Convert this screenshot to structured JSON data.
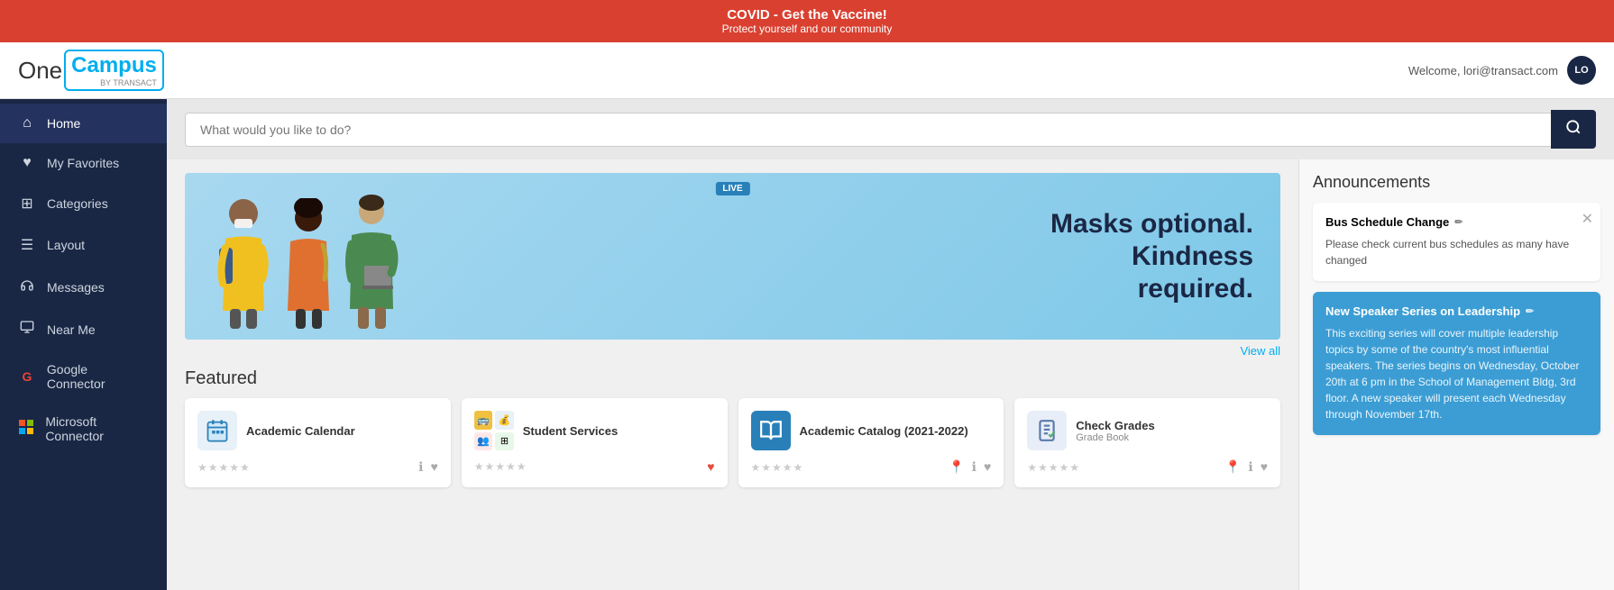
{
  "banner": {
    "title": "COVID - Get the Vaccine!",
    "subtitle": "Protect yourself and our community"
  },
  "header": {
    "logo_one": "One",
    "logo_campus": "Campus",
    "logo_by": "BY TRANSACT",
    "welcome_text": "Welcome, lori@transact.com",
    "avatar_initials": "LO"
  },
  "search": {
    "placeholder": "What would you like to do?"
  },
  "sidebar": {
    "items": [
      {
        "id": "home",
        "label": "Home",
        "icon": "⌂",
        "active": true
      },
      {
        "id": "my-favorites",
        "label": "My Favorites",
        "icon": "♥"
      },
      {
        "id": "categories",
        "label": "Categories",
        "icon": "⊞"
      },
      {
        "id": "layout",
        "label": "Layout",
        "icon": "≡"
      },
      {
        "id": "messages",
        "label": "Messages",
        "icon": "📶"
      },
      {
        "id": "near-me",
        "label": "Near Me",
        "icon": "🗺"
      },
      {
        "id": "google-connector",
        "label": "Google Connector",
        "icon": "G"
      },
      {
        "id": "microsoft-connector",
        "label": "Microsoft Connector",
        "icon": "⊞"
      }
    ]
  },
  "hero": {
    "line1": "Masks optional.",
    "line2": "Kindness",
    "line3": "required.",
    "badge": "LIVE"
  },
  "view_all_label": "View all",
  "featured": {
    "title": "Featured",
    "cards": [
      {
        "name": "Academic Calendar",
        "sub": "",
        "icon_type": "calendar",
        "has_heart": false,
        "has_location": false
      },
      {
        "name": "Student Services",
        "sub": "",
        "icon_type": "student-services",
        "has_heart": true,
        "has_location": false
      },
      {
        "name": "Academic Catalog (2021-2022)",
        "sub": "",
        "icon_type": "book",
        "has_heart": false,
        "has_location": true
      },
      {
        "name": "Check Grades",
        "sub": "Grade Book",
        "icon_type": "grades",
        "has_heart": false,
        "has_location": true
      }
    ]
  },
  "announcements": {
    "title": "Announcements",
    "items": [
      {
        "id": "bus-schedule",
        "title": "Bus Schedule Change",
        "text": "Please check current bus schedules as many have changed",
        "highlighted": false,
        "show_close": true
      },
      {
        "id": "speaker-series",
        "title": "New Speaker Series on Leadership",
        "text": "This exciting series will cover multiple leadership topics by some of the country's most influential speakers. The series begins on Wednesday, October 20th at 6 pm in the School of Management Bldg, 3rd floor. A new speaker will present each Wednesday through November 17th.",
        "highlighted": true,
        "show_close": false
      }
    ]
  }
}
